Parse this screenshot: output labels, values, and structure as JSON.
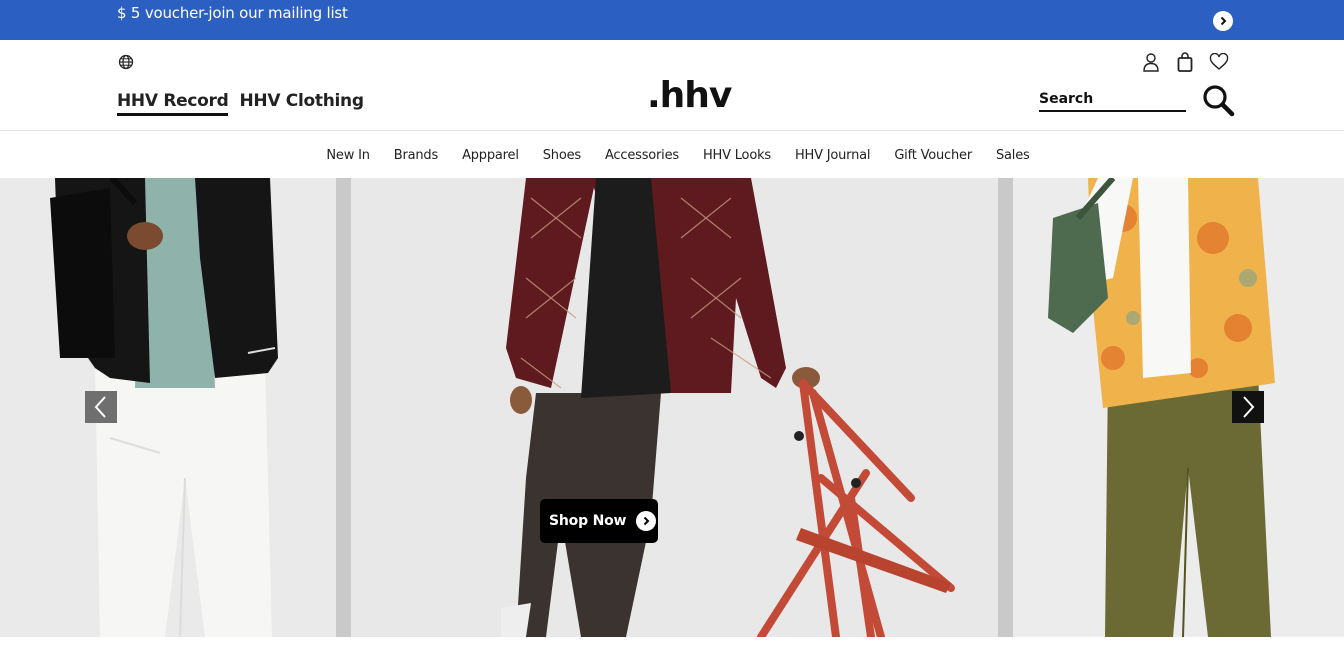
{
  "promo": {
    "text": "$ 5 voucher-join our mailing list"
  },
  "header": {
    "store_tabs": [
      {
        "label": "HHV Record",
        "active": true
      },
      {
        "label": "HHV Clothing",
        "active": false
      }
    ],
    "logo": ".hhv",
    "search": {
      "placeholder": "Search"
    },
    "icons": [
      "globe-icon",
      "user-icon",
      "bag-icon",
      "heart-icon",
      "search-icon"
    ]
  },
  "nav": {
    "items": [
      "New In",
      "Brands",
      "Appparel",
      "Shoes",
      "Accessories",
      "HHV Looks",
      "HHV Journal",
      "Gift Voucher",
      "Sales"
    ]
  },
  "hero": {
    "cta_label": "Shop Now"
  },
  "colors": {
    "promo_bg": "#2b5fc1",
    "cta_bg": "#000000",
    "text": "#111111"
  }
}
